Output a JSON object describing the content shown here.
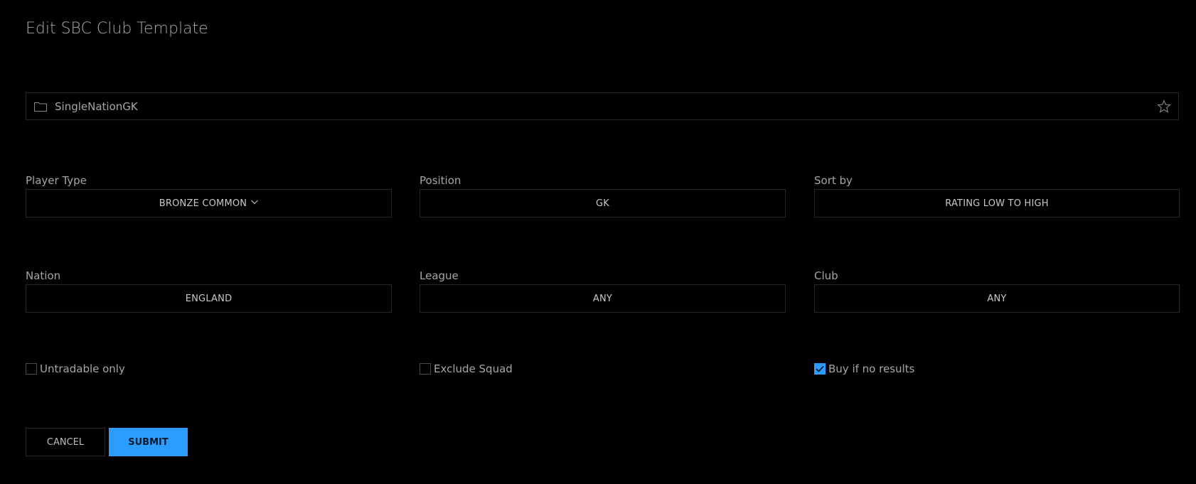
{
  "page": {
    "title": "Edit SBC Club Template"
  },
  "template_name": {
    "value": "SingleNationGK",
    "icon": "folder-icon",
    "favorite_icon": "star-icon"
  },
  "fields": [
    {
      "label": "Player Type",
      "value": "BRONZE COMMON",
      "has_dropdown": true
    },
    {
      "label": "Position",
      "value": "GK"
    },
    {
      "label": "Sort by",
      "value": "RATING LOW TO HIGH"
    },
    {
      "label": "Nation",
      "value": "ENGLAND"
    },
    {
      "label": "League",
      "value": "ANY"
    },
    {
      "label": "Club",
      "value": "ANY"
    }
  ],
  "checkboxes": [
    {
      "label": "Untradable only",
      "checked": false
    },
    {
      "label": "Exclude Squad",
      "checked": false
    },
    {
      "label": "Buy if no results",
      "checked": true
    }
  ],
  "buttons": {
    "cancel": "CANCEL",
    "submit": "SUBMIT"
  },
  "colors": {
    "accent": "#2d9cff",
    "background": "#000000",
    "border": "#262626",
    "text": "#a6a6a6"
  }
}
